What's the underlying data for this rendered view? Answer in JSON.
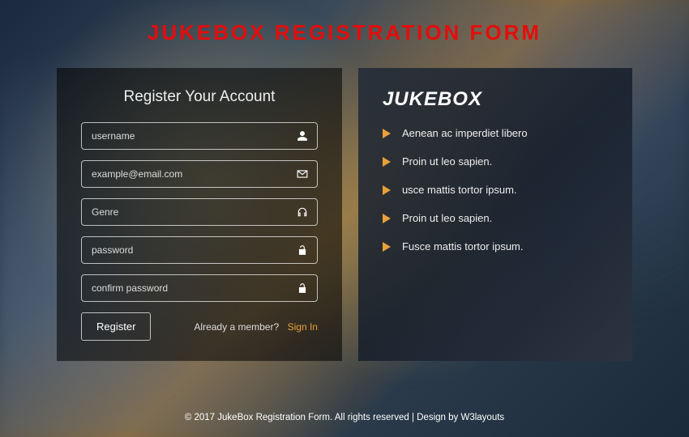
{
  "title": "JUKEBOX REGISTRATION FORM",
  "form": {
    "heading": "Register Your Account",
    "username_placeholder": "username",
    "email_placeholder": "example@email.com",
    "genre_placeholder": "Genre",
    "password_placeholder": "password",
    "confirm_placeholder": "confirm password",
    "register_label": "Register",
    "member_text": "Already a member?",
    "signin_label": "Sign In"
  },
  "info": {
    "brand": "JUKEBOX",
    "features": [
      "Aenean ac imperdiet libero",
      "Proin ut leo sapien.",
      "usce mattis tortor ipsum.",
      "Proin ut leo sapien.",
      "Fusce mattis tortor ipsum."
    ]
  },
  "footer": {
    "text": "© 2017 JukeBox Registration Form. All rights reserved | Design by ",
    "link": "W3layouts"
  }
}
